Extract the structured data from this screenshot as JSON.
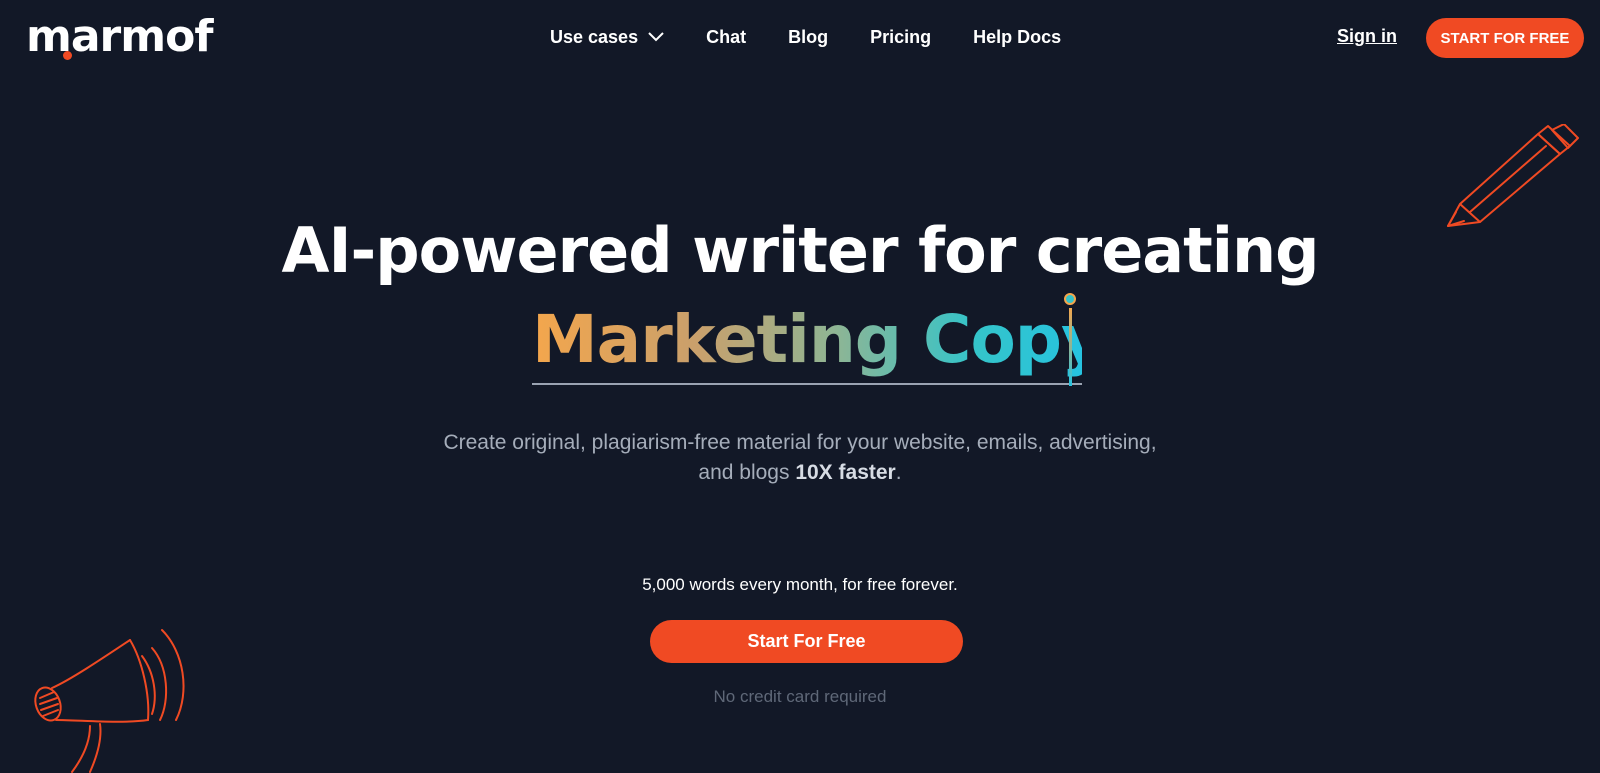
{
  "brand": {
    "logo_text": "marmof",
    "accent_color": "#f04a23",
    "background_color": "#121827"
  },
  "nav": {
    "items": [
      {
        "label": "Use cases",
        "has_dropdown": true
      },
      {
        "label": "Chat"
      },
      {
        "label": "Blog"
      },
      {
        "label": "Pricing"
      },
      {
        "label": "Help Docs"
      }
    ],
    "sign_in": "Sign in",
    "cta": "START FOR FREE"
  },
  "hero": {
    "title": "AI-powered writer for creating",
    "typed_text": "Marketing Copy.",
    "subtitle_line1": "Create original, plagiarism-free material for your website, emails, advertising,",
    "subtitle_line2_prefix": "and blogs ",
    "subtitle_line2_strong": "10X faster",
    "subtitle_line2_suffix": ".",
    "free_note": "5,000 words every month, for free forever.",
    "cta": "Start For Free",
    "no_card": "No credit card required"
  },
  "icons": {
    "chevron": "chevron-down-icon",
    "pencil": "pencil-icon",
    "megaphone": "megaphone-icon"
  }
}
